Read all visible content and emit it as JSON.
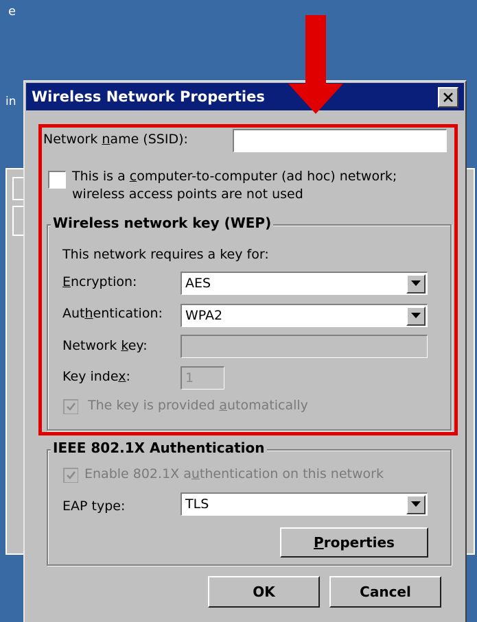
{
  "background": {
    "char_top": "e",
    "char_left": "in"
  },
  "dialog": {
    "title": "Wireless Network Properties",
    "ssid_label_pre": "Network ",
    "ssid_label_u": "n",
    "ssid_label_post": "ame (SSID):",
    "ssid_value": "",
    "adhoc_line1_pre": "This is a ",
    "adhoc_line1_u": "c",
    "adhoc_line1_post": "omputer-to-computer (ad hoc) network;",
    "adhoc_line2": "wireless access points are not used",
    "adhoc_checked": false
  },
  "wep": {
    "title": "Wireless network key (WEP)",
    "requires_label": "This network requires a key for:",
    "encryption_label_u": "E",
    "encryption_label_post": "ncryption:",
    "encryption_value": "AES",
    "auth_label_pre": "Aut",
    "auth_label_u": "h",
    "auth_label_post": "entication:",
    "auth_value": "WPA2",
    "netkey_label_pre": "Network ",
    "netkey_label_u": "k",
    "netkey_label_post": "ey:",
    "netkey_value": "",
    "keyindex_label_pre": "Key inde",
    "keyindex_label_u": "x",
    "keyindex_label_post": ":",
    "keyindex_value": "1",
    "auto_pre": "The key is provided ",
    "auto_u": "a",
    "auto_post": "utomatically",
    "auto_checked": true
  },
  "ieee": {
    "title": "IEEE 802.1X Authentication",
    "enable_pre": "Enable 802.1X a",
    "enable_u": "u",
    "enable_post": "thentication on this network",
    "enable_checked": true,
    "eap_label": "EAP type:",
    "eap_value": "TLS",
    "properties_u": "P",
    "properties_post": "roperties"
  },
  "buttons": {
    "ok": "OK",
    "cancel": "Cancel"
  },
  "colors": {
    "highlight": "#e00000",
    "titlebar": "#0a1f7a",
    "desktop": "#3a6aa4"
  }
}
